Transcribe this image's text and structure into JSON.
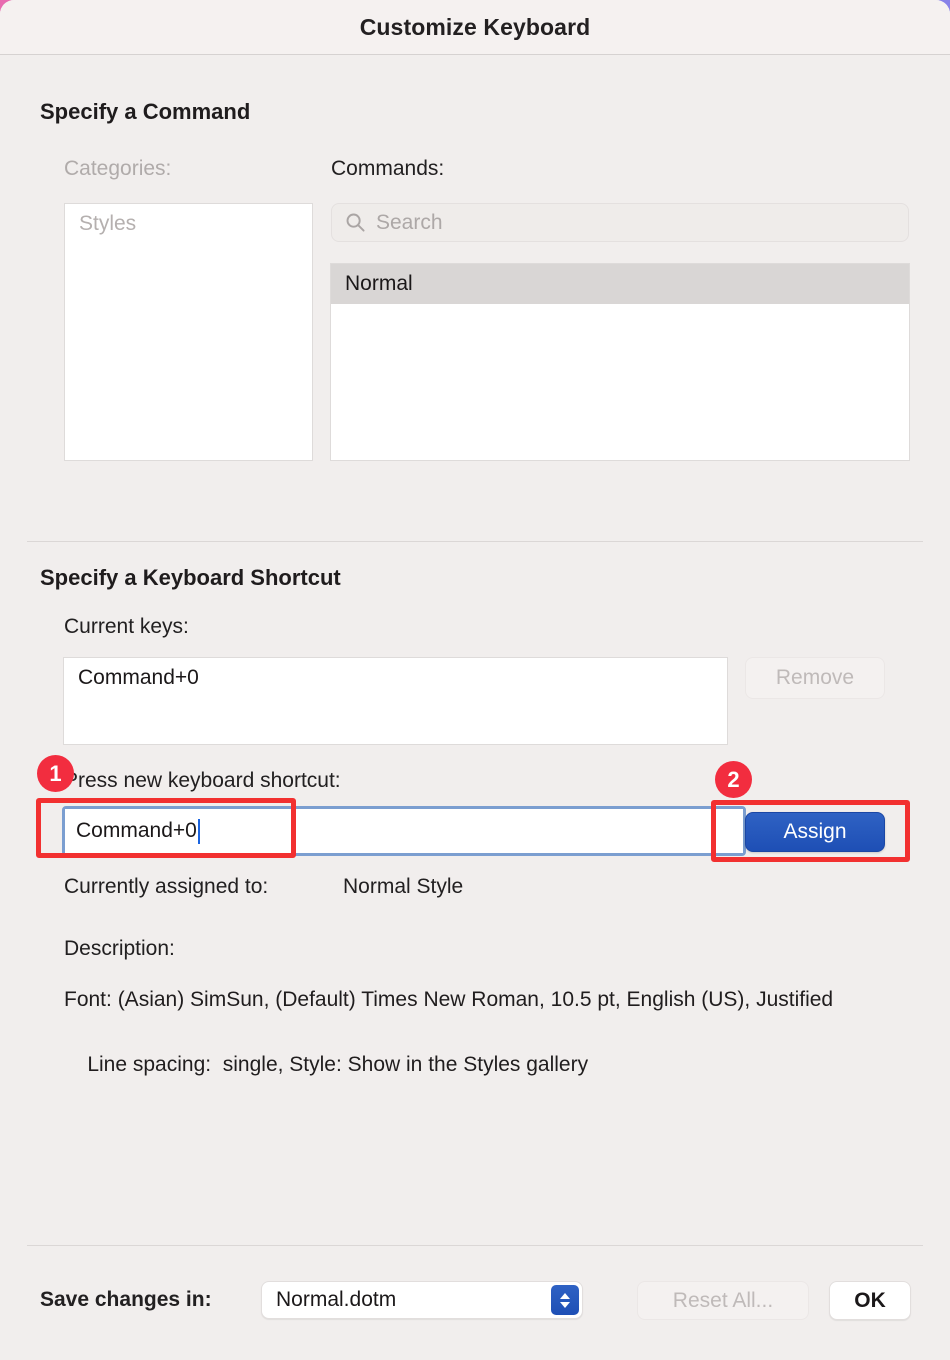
{
  "window": {
    "title": "Customize Keyboard"
  },
  "specify_command": {
    "heading": "Specify a Command",
    "categories_label": "Categories:",
    "commands_label": "Commands:",
    "categories": [
      {
        "label": "Styles",
        "state": "dimmed"
      }
    ],
    "search": {
      "placeholder": "Search",
      "value": "",
      "icon": "search-icon"
    },
    "commands": [
      {
        "label": "Normal",
        "selected": true
      }
    ]
  },
  "specify_shortcut": {
    "heading": "Specify a Keyboard Shortcut",
    "current_keys_label": "Current keys:",
    "current_keys": [
      "Command+0"
    ],
    "remove_button": {
      "label": "Remove",
      "enabled": false
    },
    "press_new_label": "Press new keyboard shortcut:",
    "new_shortcut_value": "Command+0",
    "assign_button": {
      "label": "Assign",
      "enabled": true
    },
    "currently_assigned_label": "Currently assigned to:",
    "currently_assigned_value": "Normal Style",
    "description_label": "Description:",
    "description_lines": [
      "Font: (Asian) SimSun, (Default) Times New Roman, 10.5 pt, English (US), Justified",
      "    Line spacing:  single, Style: Show in the Styles gallery"
    ]
  },
  "footer": {
    "save_changes_label": "Save changes in:",
    "save_target": "Normal.dotm",
    "save_target_options": [
      "Normal.dotm"
    ],
    "reset_all_button": {
      "label": "Reset All...",
      "enabled": false
    },
    "ok_button": {
      "label": "OK",
      "enabled": true
    }
  },
  "annotations": [
    {
      "id": "1",
      "target": "press-new-keyboard-shortcut-input"
    },
    {
      "id": "2",
      "target": "assign-button"
    }
  ],
  "colors": {
    "window_background": "#f1eeed",
    "titlebar_background": "#f5f1f0",
    "accent_blue": "#1e4fb5",
    "annotation_red": "#f23030",
    "selected_row": "#d9d6d5",
    "focus_ring": "#7b9ed0",
    "caret_blue": "#1a64e0"
  }
}
